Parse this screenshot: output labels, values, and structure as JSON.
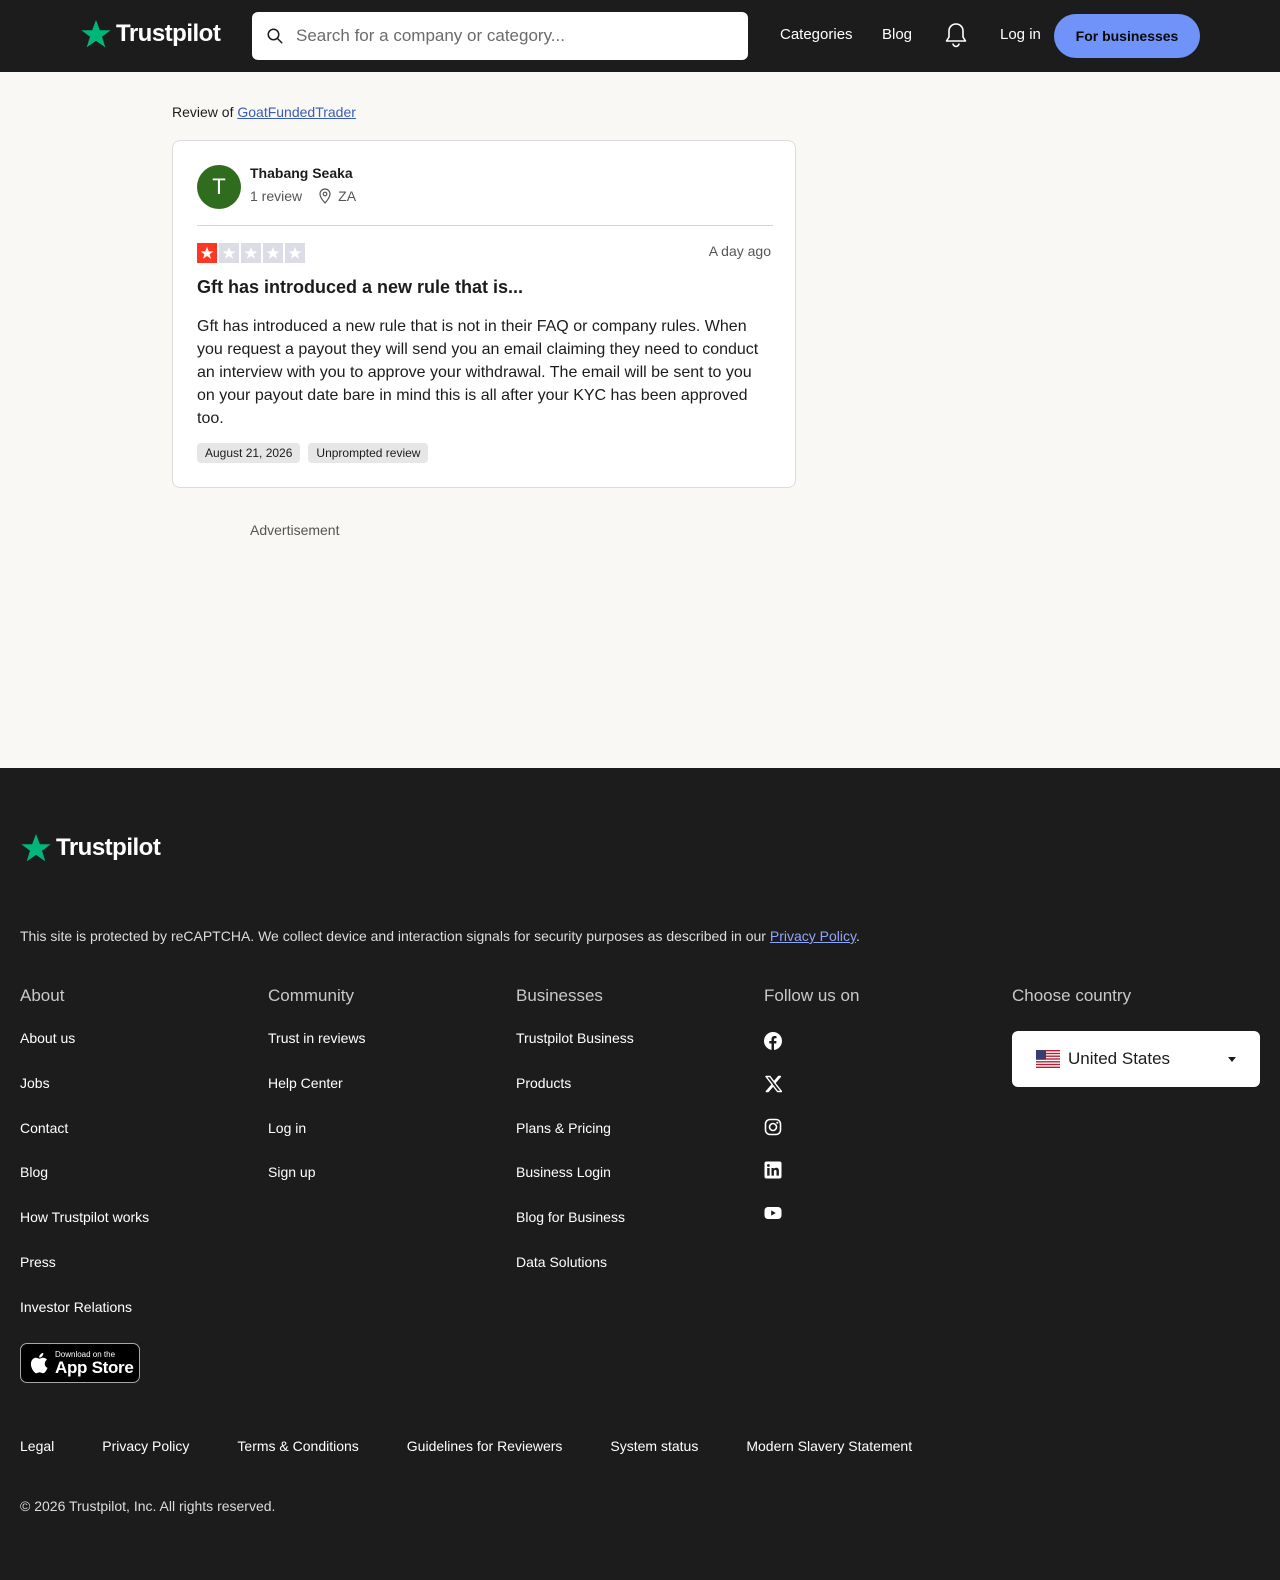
{
  "brand": {
    "name": "Trustpilot",
    "star_color": "#00b67a"
  },
  "header": {
    "search_placeholder": "Search for a company or category...",
    "nav": {
      "categories": "Categories",
      "blog": "Blog",
      "login": "Log in"
    },
    "cta": "For businesses",
    "cta_color": "#6f93f8"
  },
  "review": {
    "prefix": "Review of ",
    "company": "GoatFundedTrader",
    "reviewer": {
      "initial": "T",
      "name": "Thabang Seaka",
      "review_count": "1 review",
      "country": "ZA",
      "avatar_color": "#306c1e"
    },
    "rating": 1,
    "rating_max": 5,
    "date_relative": "A day ago",
    "title": "Gft has introduced a new rule that is...",
    "body": "Gft has introduced a new rule that is not in their FAQ or company rules. When you request a payout they will send you an email claiming they need to conduct an interview with you to approve your withdrawal. The email will be sent to you on your payout date bare in mind this is all after your KYC  has been approved too.",
    "experience_date": "August 21, 2026",
    "tag": "Unprompted review"
  },
  "ad_label": "Advertisement",
  "footer": {
    "recaptcha_text": "This site is protected by reCAPTCHA. We collect device and interaction signals for security purposes as described in our ",
    "recaptcha_link": "Privacy Policy",
    "recaptcha_end": ".",
    "columns": {
      "about": {
        "title": "About",
        "items": [
          "About us",
          "Jobs",
          "Contact",
          "Blog",
          "How Trustpilot works",
          "Press",
          "Investor Relations"
        ]
      },
      "community": {
        "title": "Community",
        "items": [
          "Trust in reviews",
          "Help Center",
          "Log in",
          "Sign up"
        ]
      },
      "businesses": {
        "title": "Businesses",
        "items": [
          "Trustpilot Business",
          "Products",
          "Plans & Pricing",
          "Business Login",
          "Blog for Business",
          "Data Solutions"
        ]
      },
      "follow": {
        "title": "Follow us on",
        "icons": [
          "facebook-icon",
          "x-icon",
          "instagram-icon",
          "linkedin-icon",
          "youtube-icon"
        ]
      },
      "country": {
        "title": "Choose country",
        "selected": "United States"
      }
    },
    "appstore": {
      "small": "Download on the",
      "big": "App Store"
    },
    "legal": [
      "Legal",
      "Privacy Policy",
      "Terms & Conditions",
      "Guidelines for Reviewers",
      "System status",
      "Modern Slavery Statement"
    ],
    "copyright": "© 2026 Trustpilot, Inc. All rights reserved."
  }
}
